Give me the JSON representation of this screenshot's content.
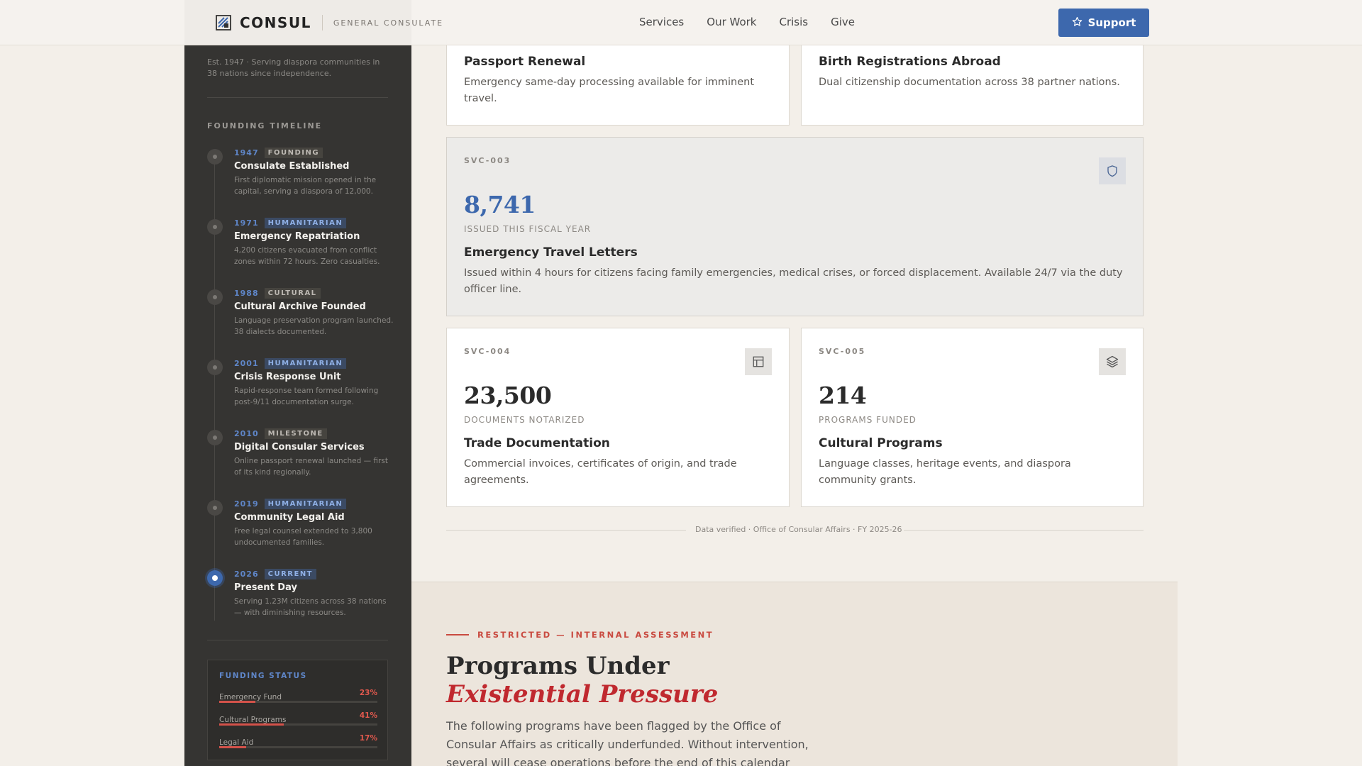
{
  "header": {
    "brand": "CONSUL",
    "subtitle": "GENERAL CONSULATE",
    "nav": [
      "Services",
      "Our Work",
      "Crisis",
      "Give"
    ],
    "support_label": "Support",
    "accent_color": "#3d68ad"
  },
  "sidebar": {
    "established": "Est. 1947 · Serving diaspora communities in 38 nations since independence.",
    "timeline_title": "FOUNDING TIMELINE",
    "timeline": [
      {
        "year": "1947",
        "tag": "FOUNDING",
        "title": "Consulate Established",
        "desc": "First diplomatic mission opened in the capital, serving a diaspora of 12,000."
      },
      {
        "year": "1971",
        "tag": "HUMANITARIAN",
        "title": "Emergency Repatriation",
        "desc": "4,200 citizens evacuated from conflict zones within 72 hours. Zero casualties."
      },
      {
        "year": "1988",
        "tag": "CULTURAL",
        "title": "Cultural Archive Founded",
        "desc": "Language preservation program launched. 38 dialects documented."
      },
      {
        "year": "2001",
        "tag": "HUMANITARIAN",
        "title": "Crisis Response Unit",
        "desc": "Rapid-response team formed following post-9/11 documentation surge."
      },
      {
        "year": "2010",
        "tag": "MILESTONE",
        "title": "Digital Consular Services",
        "desc": "Online passport renewal launched — first of its kind regionally."
      },
      {
        "year": "2019",
        "tag": "HUMANITARIAN",
        "title": "Community Legal Aid",
        "desc": "Free legal counsel extended to 3,800 undocumented families."
      },
      {
        "year": "2026",
        "tag": "CURRENT",
        "title": "Present Day",
        "desc": "Serving 1.23M citizens across 38 nations — with diminishing resources."
      }
    ],
    "funding": {
      "title": "FUNDING STATUS",
      "items": [
        {
          "label": "Emergency Fund",
          "value": "23%",
          "level": 0.23
        },
        {
          "label": "Cultural Programs",
          "value": "41%",
          "level": 0.41
        },
        {
          "label": "Legal Aid",
          "value": "17%",
          "level": 0.17
        }
      ]
    }
  },
  "services": {
    "passport": {
      "title": "Passport Renewal",
      "desc": "Emergency same-day processing available for imminent travel."
    },
    "birth": {
      "title": "Birth Registrations Abroad",
      "desc": "Dual citizenship documentation across 38 partner nations."
    },
    "svc003": {
      "code": "SVC-003",
      "stat": "8,741",
      "stat_label": "ISSUED THIS FISCAL YEAR",
      "title": "Emergency Travel Letters",
      "desc": "Issued within 4 hours for citizens facing family emergencies, medical crises, or forced displacement. Available 24/7 via the duty officer line."
    },
    "svc004": {
      "code": "SVC-004",
      "stat": "23,500",
      "stat_label": "DOCUMENTS NOTARIZED",
      "title": "Trade Documentation",
      "desc": "Commercial invoices, certificates of origin, and trade agreements."
    },
    "svc005": {
      "code": "SVC-005",
      "stat": "214",
      "stat_label": "PROGRAMS FUNDED",
      "title": "Cultural Programs",
      "desc": "Language classes, heritage events, and diaspora community grants."
    },
    "verified": "Data verified · Office of Consular Affairs · FY 2025-26"
  },
  "assessment": {
    "kicker": "RESTRICTED — INTERNAL ASSESSMENT",
    "title_line1": "Programs Under",
    "title_line2": "Existential Pressure",
    "body": "The following programs have been flagged by the Office of Consular Affairs as critically underfunded. Without intervention, several will cease operations before the end of this calendar"
  }
}
